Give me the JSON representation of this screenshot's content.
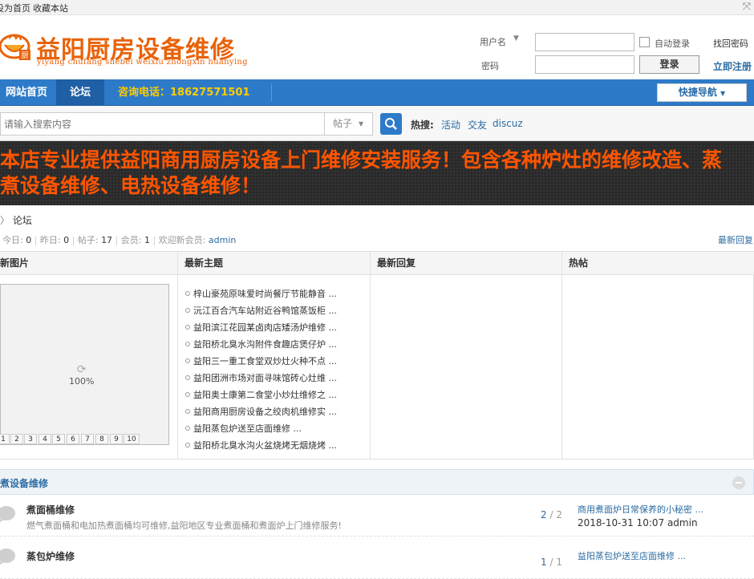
{
  "toolbar": {
    "set_home": "设为首页",
    "bookmark": "收藏本站"
  },
  "header": {
    "title": "益阳厨房设备维修",
    "subtitle": "yiyang chufang shebei weixiu zhongxin huanying",
    "logo_badge": "厨"
  },
  "login": {
    "username_label": "用户名",
    "password_label": "密码",
    "auto_login": "自动登录",
    "login_button": "登录",
    "find_password": "找回密码",
    "register": "立即注册"
  },
  "nav": {
    "home": "网站首页",
    "forum": "论坛",
    "phone": "咨询电话：18627571501",
    "quick_nav": "快捷导航"
  },
  "search": {
    "placeholder": "请输入搜索内容",
    "type": "帖子",
    "hot_label": "热搜:",
    "hot_words": [
      "活动",
      "交友",
      "discuz"
    ]
  },
  "banner": {
    "text": "本店专业提供益阳商用厨房设备上门维修安装服务！包含各种炉灶的维修改造、蒸煮设备维修、电热设备维修！"
  },
  "breadcrumb": {
    "current": "论坛"
  },
  "stats": {
    "today_label": "今日:",
    "today": "0",
    "yesterday_label": "昨日:",
    "yesterday": "0",
    "posts_label": "帖子:",
    "posts": "17",
    "members_label": "会员:",
    "members": "1",
    "welcome_label": "欢迎新会员:",
    "new_member": "admin",
    "latest_reply_link": "最新回复"
  },
  "grid": {
    "headers": {
      "images": "最新图片",
      "topics": "最新主题",
      "replies": "最新回复",
      "hot": "热帖"
    },
    "slider": {
      "loading": "100%",
      "pages": [
        "1",
        "2",
        "3",
        "4",
        "5",
        "6",
        "7",
        "8",
        "9",
        "10"
      ]
    },
    "topics": [
      "梓山豪苑原味爱时尚餐厅节能静音 ...",
      "沅江百合汽车站附近谷鸭馆蒸饭柜 ...",
      "益阳滨江花园某卤肉店矮汤炉维修 ...",
      "益阳桥北臭水沟附件食趣店煲仔炉 ...",
      "益阳三一重工食堂双炒灶火种不点 ...",
      "益阳团洲市场对面寻味馆砖心灶维 ...",
      "益阳奥士康第二食堂小炒灶维修之 ...",
      "益阳商用厨房设备之绞肉机维修实 ...",
      "益阳蒸包炉送至店面维修 ...",
      "益阳桥北臭水沟火盆烧烤无烟烧烤 ..."
    ]
  },
  "section": {
    "title": "蒸煮设备维修",
    "forums": [
      {
        "name": "煮面桶维修",
        "desc": "燃气煮面桶和电加热煮面桶均可维修,益阳地区专业煮面桶和煮面炉上门维修服务!",
        "threads": "2",
        "posts": "2",
        "last_title": "商用煮面炉日常保养的小秘密 ...",
        "last_meta": "2018-10-31 10:07 admin"
      },
      {
        "name": "蒸包炉维修",
        "desc": "",
        "threads": "1",
        "posts": "1",
        "last_title": "益阳蒸包炉送至店面维修 ...",
        "last_meta": ""
      }
    ]
  },
  "colors": {
    "brand_orange": "#e8630a",
    "nav_blue": "#2d7bc8",
    "link_blue": "#2b6ca3",
    "banner_text": "#ff5500",
    "phone_yellow": "#ffcc00"
  }
}
